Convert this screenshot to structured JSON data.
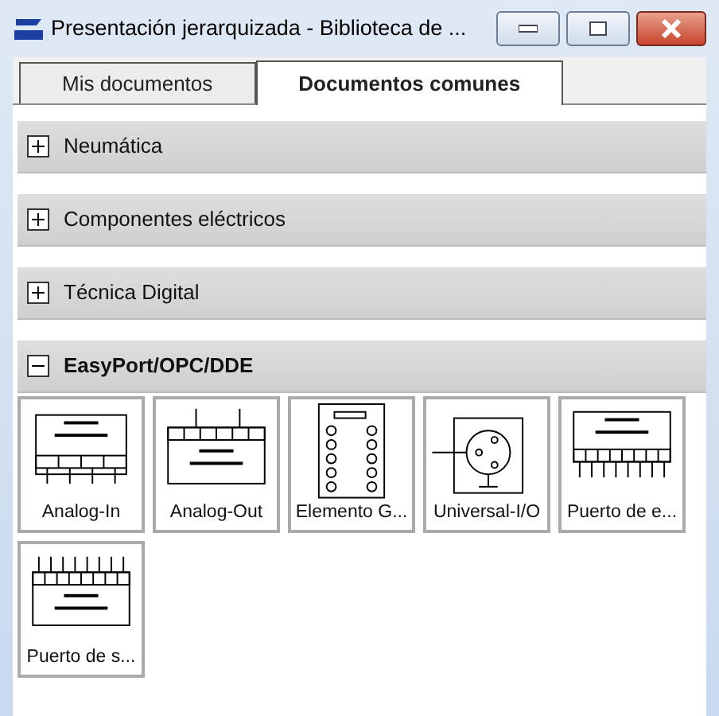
{
  "window": {
    "title": "Presentación jerarquizada - Biblioteca de ..."
  },
  "tabs": [
    {
      "label": "Mis documentos",
      "selected": false
    },
    {
      "label": "Documentos comunes",
      "selected": true
    }
  ],
  "sections": [
    {
      "label": "Neumática",
      "expanded": false
    },
    {
      "label": "Componentes eléctricos",
      "expanded": false
    },
    {
      "label": "Técnica Digital",
      "expanded": false
    },
    {
      "label": "EasyPort/OPC/DDE",
      "expanded": true,
      "items": [
        {
          "label": "Analog-In",
          "kind": "analog-in"
        },
        {
          "label": "Analog-Out",
          "kind": "analog-out"
        },
        {
          "label": "Elemento G...",
          "kind": "terminal"
        },
        {
          "label": "Universal-I/O",
          "kind": "universal"
        },
        {
          "label": "Puerto de e...",
          "kind": "port-in"
        },
        {
          "label": "Puerto de s...",
          "kind": "port-out"
        }
      ]
    }
  ]
}
